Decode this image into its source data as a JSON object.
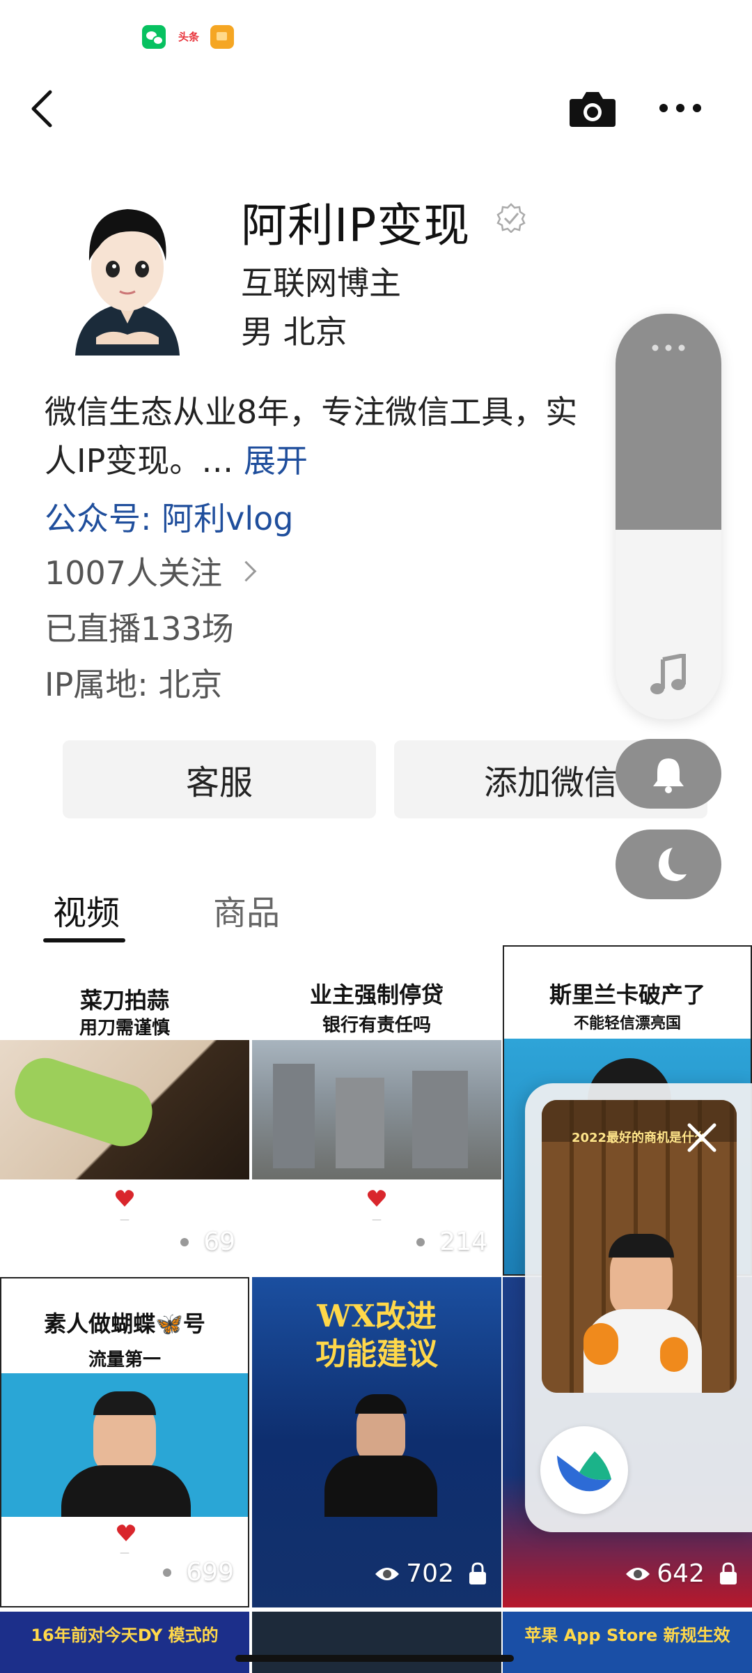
{
  "status_bar": {
    "icons": [
      "wechat-icon",
      "toutiao-icon",
      "orange-app-icon"
    ],
    "toutiao_text": "头条"
  },
  "header": {
    "back": "back-icon",
    "camera": "camera-icon",
    "more": "more-icon"
  },
  "profile": {
    "name": "阿利IP变现",
    "subtitle": "互联网博主",
    "gender_location": "男 北京",
    "bio": "微信生态从业8年，专注微信工具，实",
    "bio_line2": "人IP变现。…",
    "bio_more": "展开",
    "official_account_label": "公众号:",
    "official_account_name": "阿利vlog",
    "followers": "1007人关注",
    "live_count": "已直播133场",
    "ip_location": "IP属地: 北京"
  },
  "buttons": {
    "service": "客服",
    "add_wechat": "添加微信"
  },
  "tabs": [
    {
      "label": "视频",
      "active": true
    },
    {
      "label": "商品",
      "active": false
    }
  ],
  "videos": [
    {
      "title": "菜刀拍蒜",
      "subtitle": "用刀需谨慎",
      "views": "69",
      "locked": false
    },
    {
      "title": "业主强制停贷",
      "subtitle": "银行有责任吗",
      "views": "214",
      "locked": false
    },
    {
      "title": "斯里兰卡破产了",
      "subtitle": "不能轻信漂亮国",
      "views": "",
      "locked": false
    },
    {
      "title": "素人做蝴蝶🦋号",
      "subtitle": "流量第一",
      "views": "699",
      "locked": false
    },
    {
      "title": "WX改进",
      "subtitle": "功能建议",
      "views": "702",
      "locked": true
    },
    {
      "title": "",
      "subtitle": "",
      "views": "642",
      "locked": true
    }
  ],
  "bottom_row": {
    "left_caption": "16年前对今天DY 模式的",
    "right_caption": "苹果 App Store 新规生效"
  },
  "floating_window": {
    "video_caption": "2022最好的商机是什么",
    "close": "close-icon",
    "app": "app-logo-icon"
  },
  "colors": {
    "link_blue": "#1f4e9c",
    "panel_gray": "#8e8e8e",
    "button_bg": "#f3f3f3"
  }
}
